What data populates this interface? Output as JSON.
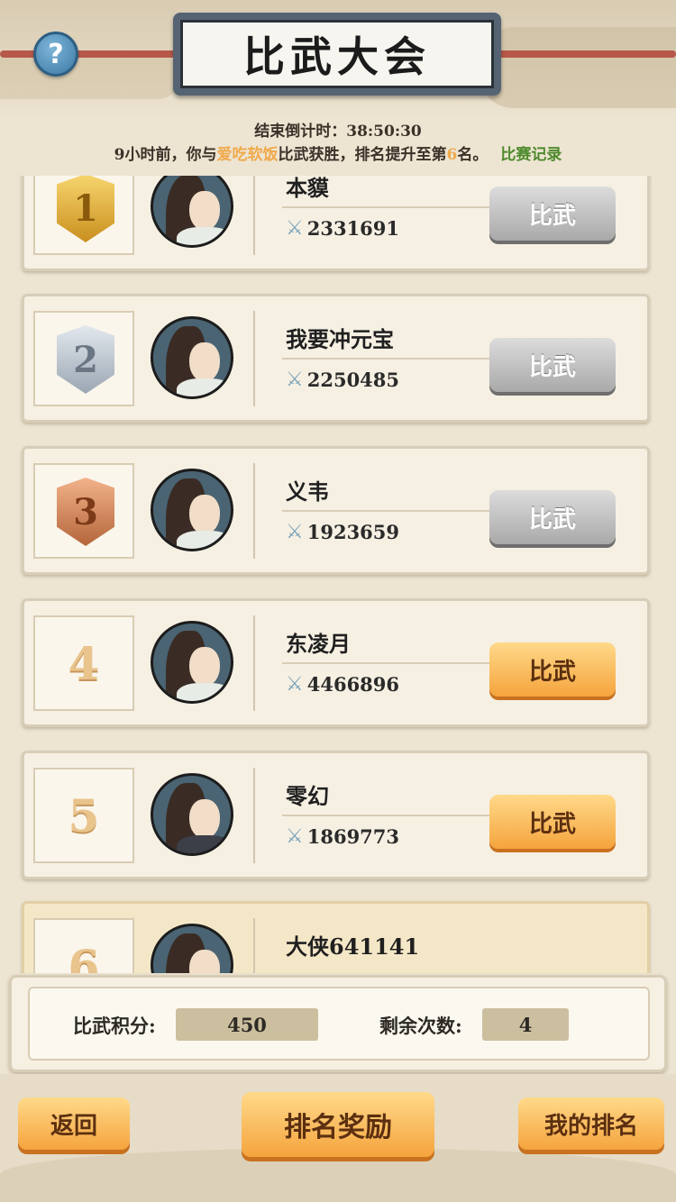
{
  "header": {
    "title": "比武大会",
    "help_label": "?"
  },
  "countdown": {
    "label": "结束倒计时：",
    "value": "38:50:30"
  },
  "news": {
    "prefix": "9小时前，你与",
    "opponent": "爱吃软饭",
    "middle": "比武获胜，排名提升至第",
    "rank": "6",
    "suffix": "名。",
    "record_link": "比赛记录"
  },
  "ranking": [
    {
      "rank": "1",
      "badge": "gold",
      "name": "本貘",
      "power": "2331691",
      "button": "比武",
      "button_state": "disabled"
    },
    {
      "rank": "2",
      "badge": "silver",
      "name": "我要冲元宝",
      "power": "2250485",
      "button": "比武",
      "button_state": "disabled"
    },
    {
      "rank": "3",
      "badge": "bronze",
      "name": "义韦",
      "power": "1923659",
      "button": "比武",
      "button_state": "disabled"
    },
    {
      "rank": "4",
      "badge": "none",
      "name": "东凌月",
      "power": "4466896",
      "button": "比武",
      "button_state": "active"
    },
    {
      "rank": "5",
      "badge": "none",
      "name": "零幻",
      "power": "1869773",
      "button": "比武",
      "button_state": "active"
    },
    {
      "rank": "6",
      "badge": "none",
      "name": "大侠641141",
      "power": "",
      "button": "",
      "button_state": "self"
    }
  ],
  "stats": {
    "score_label": "比武积分:",
    "score_value": "450",
    "remaining_label": "剩余次数:",
    "remaining_value": "4"
  },
  "footer": {
    "back": "返回",
    "reward": "排名奖励",
    "my_rank": "我的排名"
  },
  "icons": {
    "power": "crossed-swords-icon",
    "help": "question-icon"
  }
}
